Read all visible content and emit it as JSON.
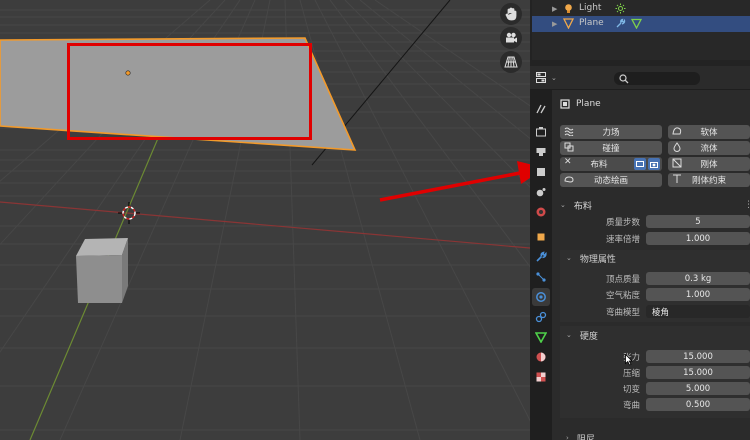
{
  "viewport": {
    "tools": [
      {
        "name": "hand-icon"
      },
      {
        "name": "camera-icon"
      },
      {
        "name": "grid-icon"
      }
    ],
    "objects": [
      "Plane",
      "Cube",
      "3D Cursor"
    ]
  },
  "outliner": {
    "rows": [
      {
        "label": "Light",
        "icon": "light-icon",
        "extra_icon": "sun-data-icon",
        "selected": false
      },
      {
        "label": "Plane",
        "icon": "mesh-object-icon",
        "extra_icon": "modifier-wrench-icon",
        "extra_icon2": "mesh-data-icon",
        "selected": true
      }
    ]
  },
  "properties": {
    "object_name": "Plane",
    "physics_buttons": [
      {
        "label": "力场",
        "icon": "force-field-icon"
      },
      {
        "label": "软体",
        "icon": "soft-body-icon"
      },
      {
        "label": "碰撞",
        "icon": "collision-icon"
      },
      {
        "label": "流体",
        "icon": "fluid-icon"
      },
      {
        "label": "布料",
        "icon": "close-icon"
      },
      {
        "label": "刚体",
        "icon": "rigid-body-icon"
      },
      {
        "label": "动态绘画",
        "icon": "dynamic-paint-icon"
      },
      {
        "label": "刚体约束",
        "icon": "rigid-body-constraint-icon"
      }
    ],
    "cloth_panel": {
      "title": "布料",
      "quality_label": "质量步数",
      "quality_value": "5",
      "speed_label": "速率倍增",
      "speed_value": "1.000"
    },
    "physical_props": {
      "title": "物理属性",
      "vertex_mass_label": "顶点质量",
      "vertex_mass_value": "0.3 kg",
      "air_viscosity_label": "空气粘度",
      "air_viscosity_value": "1.000",
      "bending_model_label": "弯曲模型",
      "bending_model_value": "棱角"
    },
    "stiffness": {
      "title": "硬度",
      "tension_label": "张力",
      "tension_value": "15.000",
      "compression_label": "压缩",
      "compression_value": "15.000",
      "shear_label": "切变",
      "shear_value": "5.000",
      "bending_label": "弯曲",
      "bending_value": "0.500"
    },
    "damping": {
      "title": "阻尼"
    }
  },
  "colors": {
    "selection_orange": "#f39a2a",
    "annotation_red": "#e00000",
    "selected_row": "#334d80",
    "x_axis": "#a33a3a",
    "y_axis": "#7e9a3a"
  }
}
